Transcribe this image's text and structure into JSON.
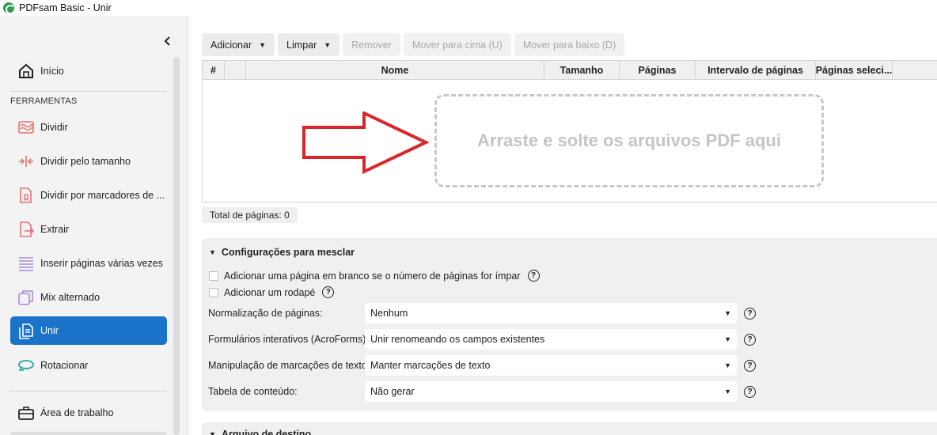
{
  "window": {
    "title": "PDFsam Basic - Unir"
  },
  "sidebar": {
    "home": "Início",
    "section_label": "FERRAMENTAS",
    "tools": [
      {
        "label": "Dividir",
        "icon": "split-icon",
        "color": "#e57373"
      },
      {
        "label": "Dividir pelo tamanho",
        "icon": "split-by-size-icon",
        "color": "#e57373"
      },
      {
        "label": "Dividir por marcadores de ...",
        "icon": "split-by-bookmarks-icon",
        "color": "#e57373"
      },
      {
        "label": "Extrair",
        "icon": "extract-icon",
        "color": "#e57373"
      },
      {
        "label": "Inserir páginas várias vezes",
        "icon": "insert-pages-icon",
        "color": "#a78bd4"
      },
      {
        "label": "Mix alternado",
        "icon": "alternate-mix-icon",
        "color": "#a78bd4"
      },
      {
        "label": "Unir",
        "icon": "merge-icon",
        "color": "#ffffff",
        "active": true
      },
      {
        "label": "Rotacionar",
        "icon": "rotate-icon",
        "color": "#26a69a"
      }
    ],
    "workspace": "Área de trabalho"
  },
  "toolbar": {
    "add": "Adicionar",
    "clear": "Limpar",
    "remove": "Remover",
    "move_up": "Mover para cima (U)",
    "move_down": "Mover para baixo (D)"
  },
  "table": {
    "columns": [
      "#",
      "",
      "Nome",
      "Tamanho",
      "Páginas",
      "Intervalo de páginas",
      "Páginas seleci..."
    ],
    "rows": [],
    "dropzone_text": "Arraste e solte os arquivos PDF aqui"
  },
  "total_pages": "Total de páginas: 0",
  "merge_settings": {
    "title": "Configurações para mesclar",
    "blank_page_label": "Adicionar uma página em branco se o número de páginas for ímpar",
    "footer_label": "Adicionar um rodapé",
    "normalization": {
      "label": "Normalização de páginas:",
      "value": "Nenhum"
    },
    "acroforms": {
      "label": "Formulários interativos (AcroForms)",
      "value": "Unir renomeando os campos existentes"
    },
    "bookmarks": {
      "label": "Manipulação de marcações de texto:",
      "value": "Manter marcações de texto"
    },
    "toc": {
      "label": "Tabela de conteúdo:",
      "value": "Não gerar"
    }
  },
  "destination": {
    "title": "Arquivo de destino"
  },
  "colors": {
    "accent": "#1a73c9",
    "arrow": "#d9262c"
  }
}
